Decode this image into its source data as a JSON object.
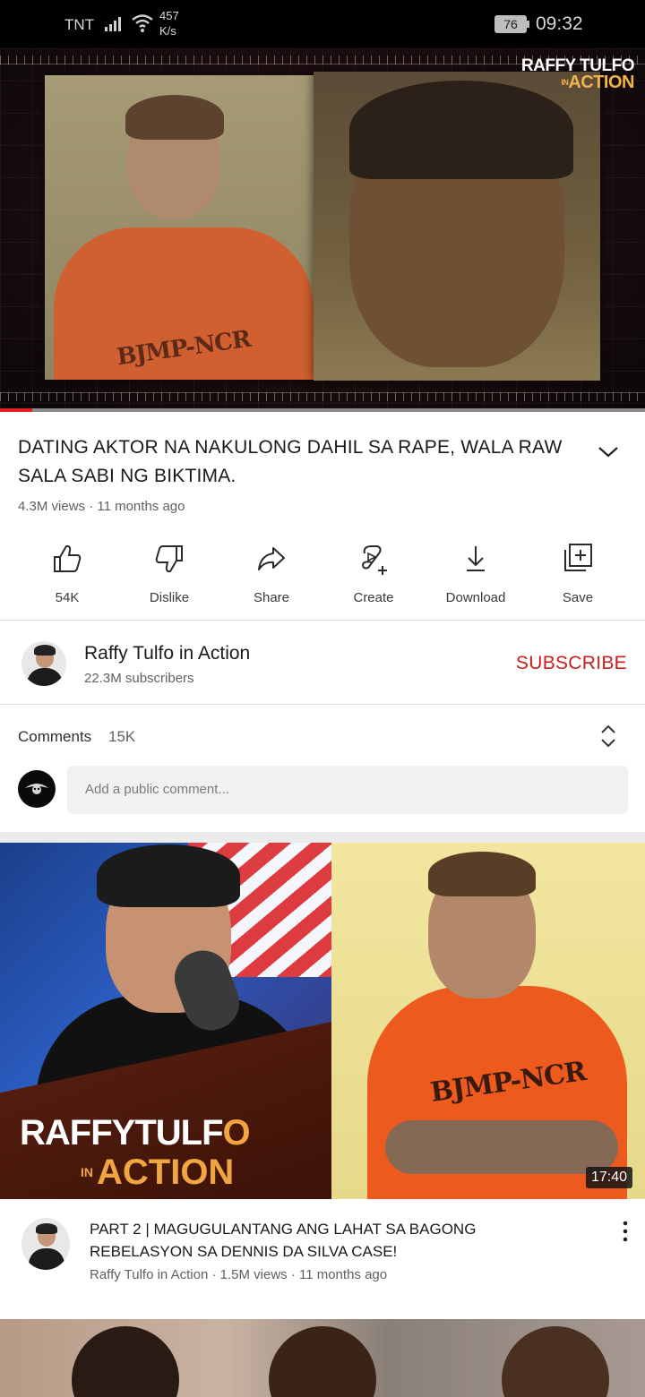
{
  "status_bar": {
    "carrier": "TNT",
    "net_speed_value": "457",
    "net_speed_unit": "K/s",
    "battery": "76",
    "time": "09:32"
  },
  "player": {
    "brand_line1": "RAFFY TULFO",
    "brand_in": "IN",
    "brand_line2": "ACTION",
    "shirt_text": "BJMP-NCR",
    "progress_fraction": 0.05
  },
  "video": {
    "title": "DATING AKTOR NA NAKULONG DAHIL SA RAPE, WALA RAW SALA SABI NG BIKTIMA.",
    "meta": "4.3M views · 11 months ago"
  },
  "actions": [
    {
      "label": "54K",
      "icon": "thumbs-up-icon"
    },
    {
      "label": "Dislike",
      "icon": "thumbs-down-icon"
    },
    {
      "label": "Share",
      "icon": "share-icon"
    },
    {
      "label": "Create",
      "icon": "create-icon"
    },
    {
      "label": "Download",
      "icon": "download-icon"
    },
    {
      "label": "Save",
      "icon": "save-playlist-icon"
    }
  ],
  "channel": {
    "name": "Raffy Tulfo in Action",
    "subscribers": "22.3M subscribers",
    "subscribe_label": "SUBSCRIBE"
  },
  "comments": {
    "label": "Comments",
    "count": "15K",
    "placeholder": "Add a public comment..."
  },
  "next_video": {
    "brand_line1_a": "RAFFYTULF",
    "brand_line1_b": "O",
    "brand_in": "IN",
    "brand_line2": "ACTION",
    "shirt_text": "BJMP-NCR",
    "duration": "17:40",
    "title": "PART 2 | MAGUGULANTANG ANG LAHAT SA BAGONG REBELASYON SA DENNIS DA SILVA CASE!",
    "meta": "Raffy Tulfo in Action · 1.5M views · 11 months ago"
  },
  "colors": {
    "accent_red": "#cc1d1d",
    "progress_red": "#e02020",
    "brand_orange": "#f0a540"
  }
}
